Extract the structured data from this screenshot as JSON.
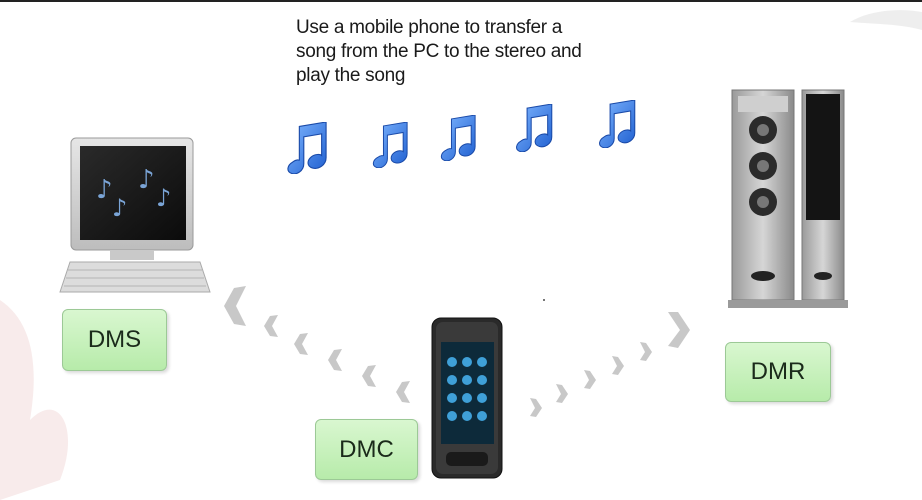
{
  "caption": {
    "line1": "Use a mobile phone to transfer a",
    "line2": "song from the PC to the stereo and",
    "line3": "play the song"
  },
  "labels": {
    "dms": "DMS",
    "dmc": "DMC",
    "dmr": "DMR"
  },
  "colors": {
    "label_fill": "#c6f0bb",
    "note_blue": "#2f78e0",
    "arrow_gray": "#c8c8c8"
  },
  "icons": [
    "computer-icon",
    "music-note-icon",
    "mobile-phone-icon",
    "speaker-icon",
    "chevron-left-icon",
    "chevron-right-icon"
  ]
}
